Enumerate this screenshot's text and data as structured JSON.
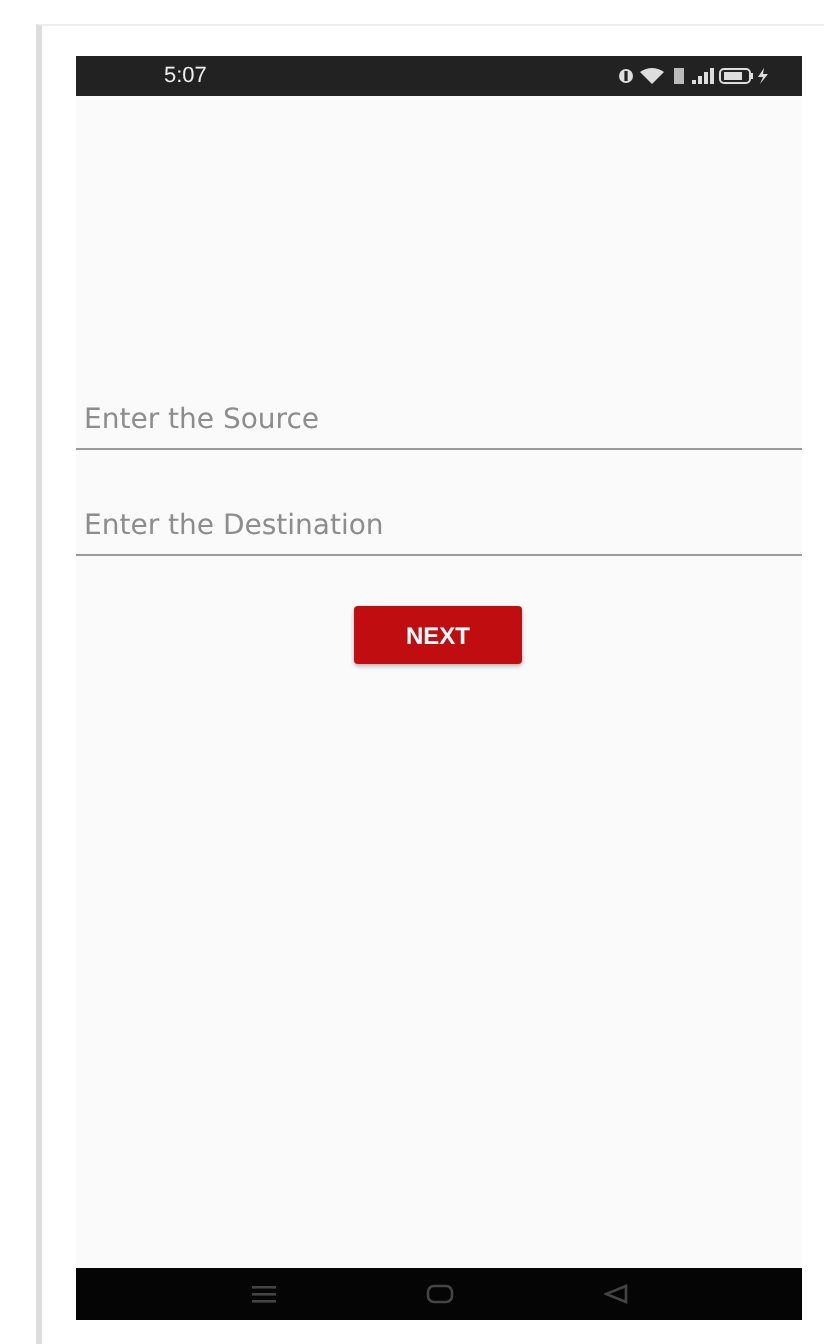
{
  "status_bar": {
    "time": "5:07"
  },
  "fields": [
    {
      "placeholder": "Enter the Source"
    },
    {
      "placeholder": "Enter the Destination"
    }
  ],
  "buttons": [
    {
      "label": "NEXT"
    }
  ]
}
